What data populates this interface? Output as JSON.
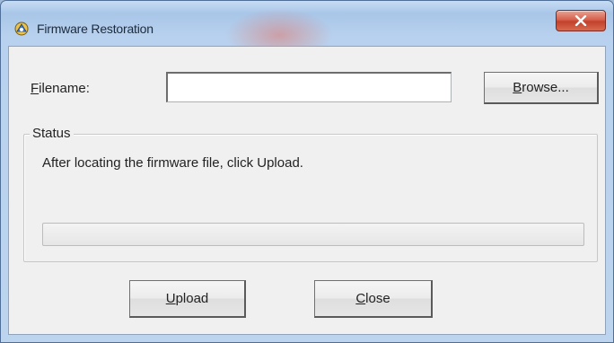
{
  "window": {
    "title": "Firmware Restoration",
    "close_glyph": "x"
  },
  "form": {
    "filename_label_accel": "F",
    "filename_label_rest": "ilename:",
    "filename_value": "",
    "browse_accel": "B",
    "browse_rest": "rowse..."
  },
  "status": {
    "legend": "Status",
    "message": "After locating the firmware file, click Upload.",
    "progress": 0
  },
  "actions": {
    "upload_accel": "U",
    "upload_rest": "pload",
    "close_accel": "C",
    "close_rest": "lose"
  },
  "colors": {
    "close_button": "#c2412c",
    "progress_fill": "#4cc12d"
  }
}
